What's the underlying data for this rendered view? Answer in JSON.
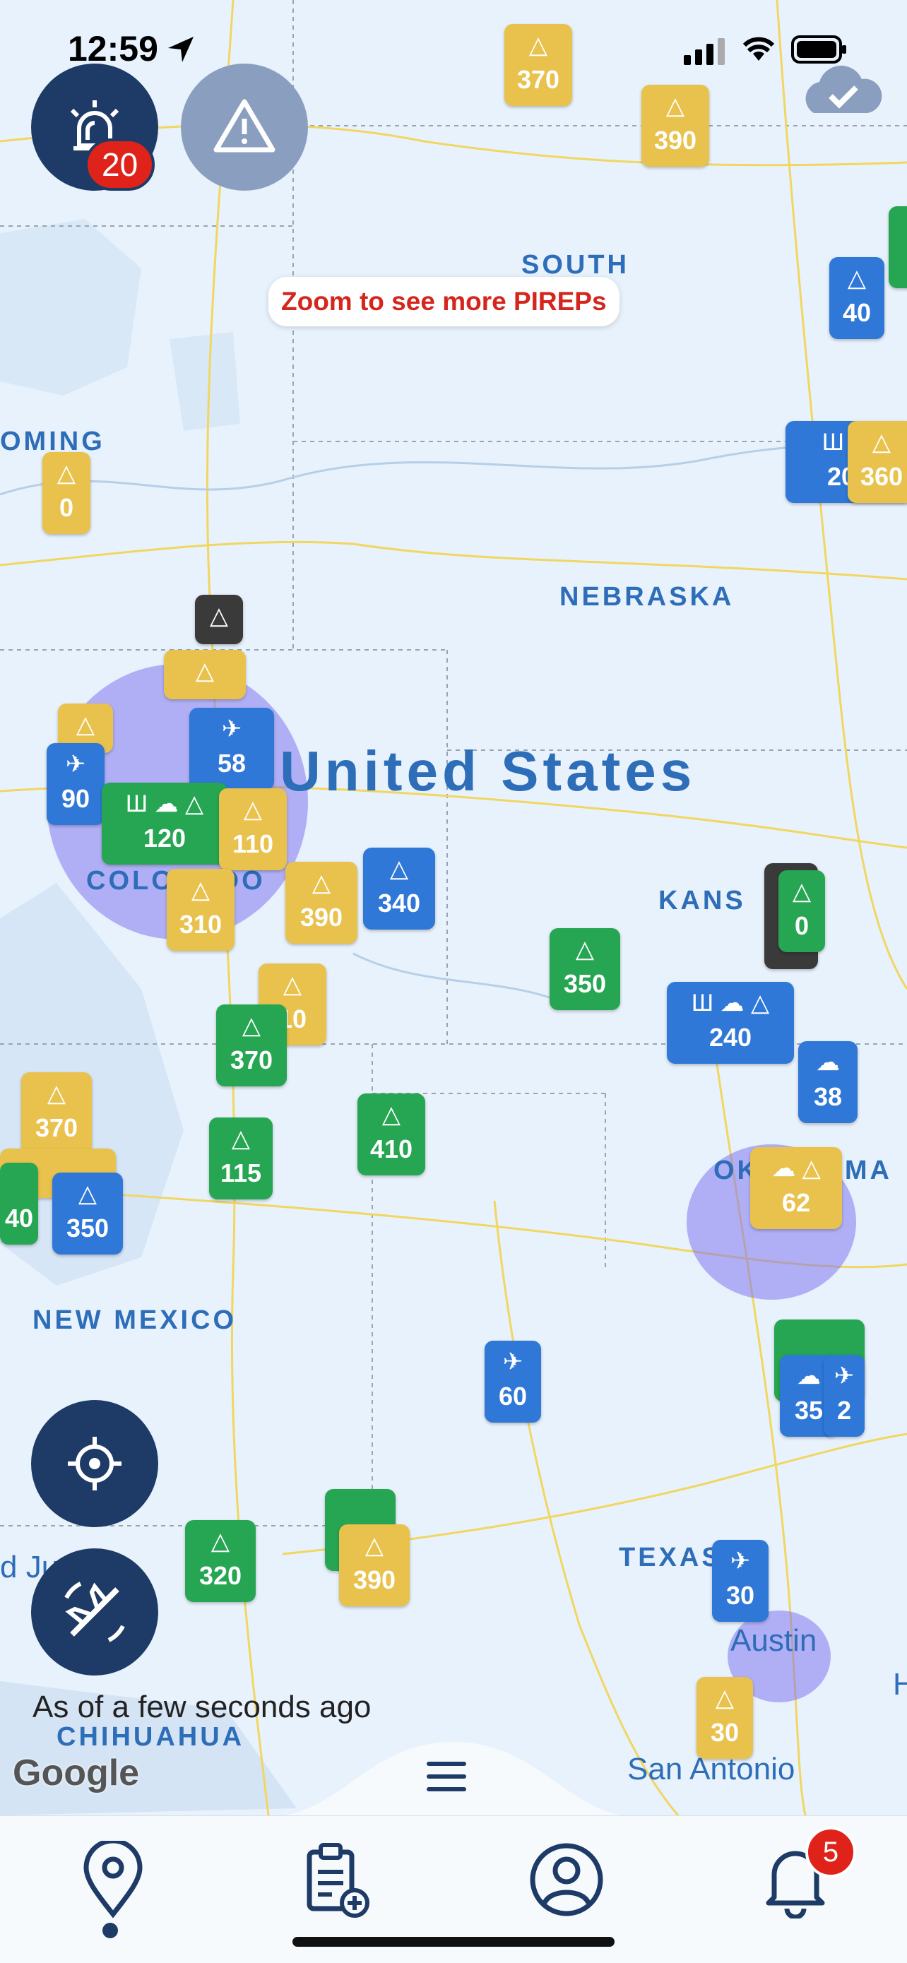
{
  "status_bar": {
    "time": "12:59"
  },
  "alerts": {
    "badge_count": "20"
  },
  "toast": {
    "text": "Zoom to see more PIREPs"
  },
  "map": {
    "country": "United States",
    "labels": {
      "south": "SOUTH",
      "oming": "OMING",
      "nebraska": "NEBRASKA",
      "kans": "KANS",
      "colorado": "COLORADO",
      "new_mexico": "NEW MEXICO",
      "okla": "OK      OMA",
      "texas": "TEXAS",
      "chihuahua": "CHIHUAHUA",
      "austin": "Austin",
      "san_antonio": "San Antonio",
      "ju": "d Ju",
      "h": "H"
    },
    "markers": [
      {
        "v": "370",
        "c": "y",
        "icon": "△"
      },
      {
        "v": "390",
        "c": "y",
        "icon": "△"
      },
      {
        "v": "40",
        "c": "b",
        "icon": "△"
      },
      {
        "v": "0",
        "c": "y",
        "icon": "△"
      },
      {
        "v": "200",
        "c": "b",
        "icon": "Ш ☁"
      },
      {
        "v": "360",
        "c": "y",
        "icon": "△"
      },
      {
        "v": "90",
        "c": "b",
        "icon": "✈"
      },
      {
        "v": "58",
        "c": "b",
        "icon": "✈"
      },
      {
        "v": "120",
        "c": "g",
        "icon": "Ш ☁ △"
      },
      {
        "v": "110",
        "c": "y",
        "icon": "△"
      },
      {
        "v": "310",
        "c": "y",
        "icon": "△"
      },
      {
        "v": "390",
        "c": "y",
        "icon": "△"
      },
      {
        "v": "340",
        "c": "b",
        "icon": "△"
      },
      {
        "v": "350",
        "c": "g",
        "icon": "△"
      },
      {
        "v": "0",
        "c": "g",
        "icon": "△"
      },
      {
        "v": "240",
        "c": "b",
        "icon": "Ш ☁ △"
      },
      {
        "v": "38",
        "c": "b",
        "icon": "☁"
      },
      {
        "v": "370",
        "c": "g",
        "icon": "△"
      },
      {
        "v": "10",
        "c": "y",
        "icon": "△"
      },
      {
        "v": "370",
        "c": "y",
        "icon": "△"
      },
      {
        "v": "115",
        "c": "g",
        "icon": "△"
      },
      {
        "v": "410",
        "c": "g",
        "icon": "△"
      },
      {
        "v": "350",
        "c": "b",
        "icon": "△"
      },
      {
        "v": "40",
        "c": "g",
        "icon": "△"
      },
      {
        "v": "62",
        "c": "y",
        "icon": "☁ △"
      },
      {
        "v": "60",
        "c": "b",
        "icon": "✈"
      },
      {
        "v": "35",
        "c": "b",
        "icon": "☁"
      },
      {
        "v": "2",
        "c": "b",
        "icon": "✈"
      },
      {
        "v": "320",
        "c": "g",
        "icon": "△"
      },
      {
        "v": "390",
        "c": "y",
        "icon": "△"
      },
      {
        "v": "30",
        "c": "b",
        "icon": "✈"
      },
      {
        "v": "30",
        "c": "y",
        "icon": "△"
      }
    ]
  },
  "footer": {
    "timestamp": "As of a few seconds ago",
    "google": "Google"
  },
  "tabbar": {
    "notifications_badge": "5"
  },
  "colors": {
    "navy": "#1d3b66",
    "yellow": "#e9c24d",
    "green": "#26a653",
    "blue": "#2f78d8",
    "red": "#e0231a"
  }
}
